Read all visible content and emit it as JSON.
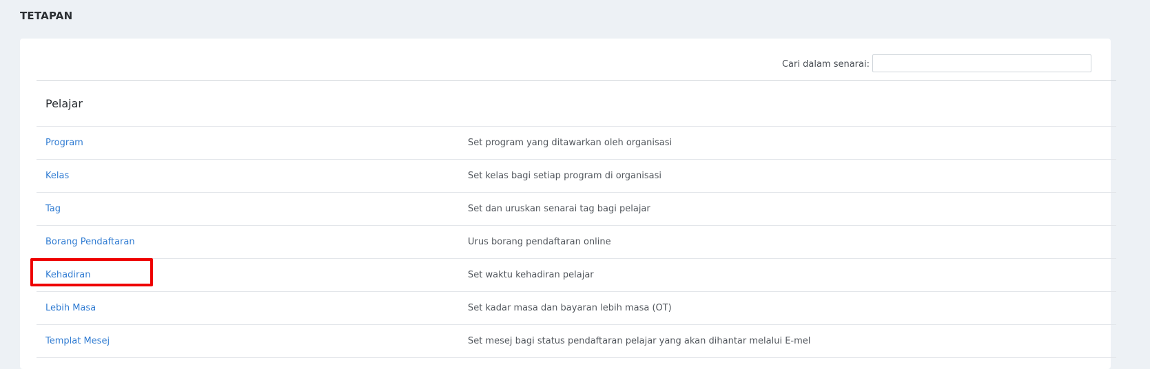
{
  "page": {
    "title": "TETAPAN"
  },
  "search": {
    "label": "Cari dalam senarai:",
    "value": "",
    "placeholder": ""
  },
  "section": {
    "header": "Pelajar"
  },
  "rows": [
    {
      "name": "Program",
      "description": "Set program yang ditawarkan oleh organisasi"
    },
    {
      "name": "Kelas",
      "description": "Set kelas bagi setiap program di organisasi"
    },
    {
      "name": "Tag",
      "description": "Set dan uruskan senarai tag bagi pelajar"
    },
    {
      "name": "Borang Pendaftaran",
      "description": "Urus borang pendaftaran online"
    },
    {
      "name": "Kehadiran",
      "description": "Set waktu kehadiran pelajar"
    },
    {
      "name": "Lebih Masa",
      "description": "Set kadar masa dan bayaran lebih masa (OT)"
    },
    {
      "name": "Templat Mesej",
      "description": "Set mesej bagi status pendaftaran pelajar yang akan dihantar melalui E-mel"
    }
  ],
  "colors": {
    "page_bg": "#edf1f5",
    "card_bg": "#ffffff",
    "link": "#2f7bd2",
    "highlight": "#ee0000"
  }
}
